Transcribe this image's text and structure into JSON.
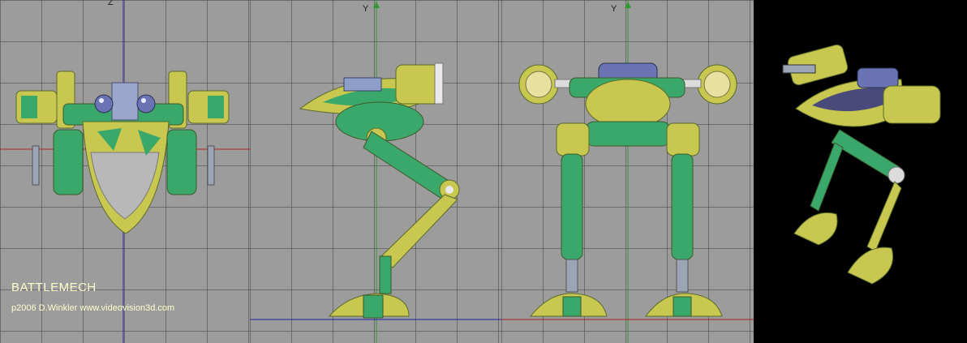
{
  "viewports": {
    "front": {
      "axis_label": "Z"
    },
    "side": {
      "axis_label": "Y"
    },
    "back": {
      "axis_label": "Y"
    }
  },
  "caption": {
    "title": "BATTLEMECH",
    "credit": "p2006 D.Winkler  www.videovision3d.com"
  },
  "colors": {
    "grid_bg": "#9c9c9c",
    "axis_green": "#2e9a2e",
    "axis_blue": "#2020a0",
    "axis_red": "#b02020",
    "camo_green": "#3aa86a",
    "camo_yellow": "#c8c850",
    "caption": "#ffffcc",
    "render_bg": "#000000"
  }
}
